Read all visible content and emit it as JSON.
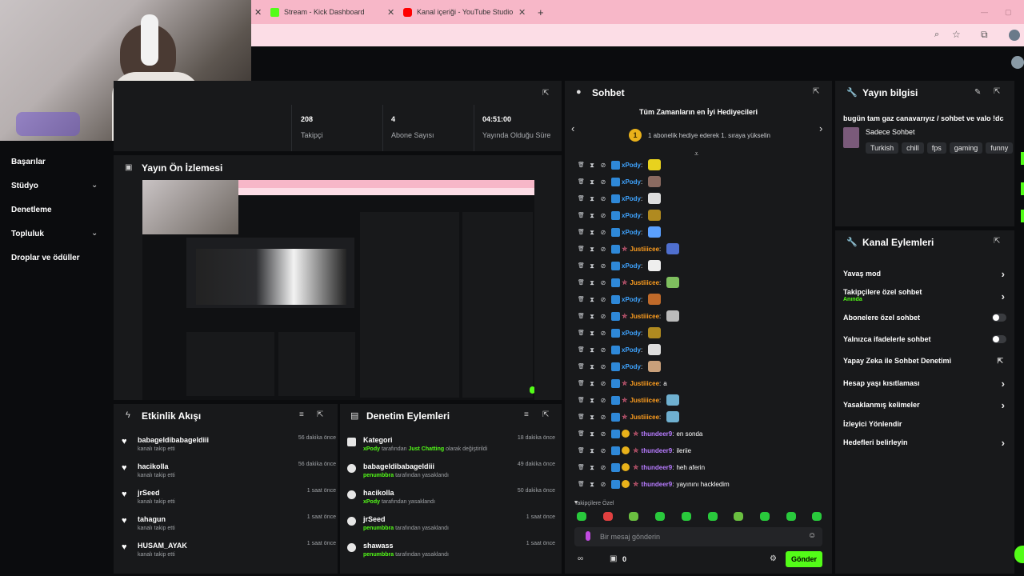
{
  "browser": {
    "tabs": [
      {
        "label": "Stream - Kick Dashboard",
        "icon": "kick-favicon-icon"
      },
      {
        "label": "Kanal içeriği - YouTube Studio",
        "icon": "youtube-favicon-icon"
      }
    ],
    "new_tab": "+"
  },
  "sidebar": {
    "items": [
      {
        "label": "Başarılar"
      },
      {
        "label": "Stüdyo"
      },
      {
        "label": "Denetleme"
      },
      {
        "label": "Topluluk"
      },
      {
        "label": "Droplar ve ödüller"
      }
    ]
  },
  "stats": [
    {
      "value": "208",
      "label": "Takipçi"
    },
    {
      "value": "4",
      "label": "Abone Sayısı"
    },
    {
      "value": "04:51:00",
      "label": "Yayında Olduğu Süre"
    }
  ],
  "preview": {
    "title": "Yayın Ön İzlemesi"
  },
  "activity": {
    "title": "Etkinlik Akışı",
    "rows": [
      {
        "name": "babageldibabageldiii",
        "action": "kanalı takip etti",
        "time": "56 dakika önce"
      },
      {
        "name": "hacikolla",
        "action": "kanalı takip etti",
        "time": "56 dakika önce"
      },
      {
        "name": "jrSeed",
        "action": "kanalı takip etti",
        "time": "1 saat önce"
      },
      {
        "name": "tahagun",
        "action": "kanalı takip etti",
        "time": "1 saat önce"
      },
      {
        "name": "HUSAM_AYAK",
        "action": "kanalı takip etti",
        "time": "1 saat önce"
      }
    ]
  },
  "moderation": {
    "title": "Denetim Eylemleri",
    "rows": [
      {
        "name": "Kategori",
        "actor": "xPody",
        "middle": " tarafından ",
        "highlight": "Just Chatting",
        "rest": " olarak değiştirildi",
        "time": "18 dakika önce",
        "icon": "category-icon"
      },
      {
        "name": "babageldibabageldiii",
        "actor": "penumbbra",
        "middle": " tarafından yasaklandı",
        "highlight": "",
        "rest": "",
        "time": "49 dakika önce",
        "icon": "ban-icon"
      },
      {
        "name": "hacikolla",
        "actor": "xPody",
        "middle": " tarafından yasaklandı",
        "highlight": "",
        "rest": "",
        "time": "50 dakika önce",
        "icon": "ban-icon"
      },
      {
        "name": "jrSeed",
        "actor": "penumbbra",
        "middle": " tarafından yasaklandı",
        "highlight": "",
        "rest": "",
        "time": "1 saat önce",
        "icon": "ban-icon"
      },
      {
        "name": "shawass",
        "actor": "penumbbra",
        "middle": " tarafından yasaklandı",
        "highlight": "",
        "rest": "",
        "time": "1 saat önce",
        "icon": "ban-icon"
      }
    ]
  },
  "chat": {
    "title": "Sohbet",
    "gifters_title": "Tüm Zamanların en İyi Hediyecileri",
    "gifters_sub": "1 abonelik hediye ederek 1. sıraya yükselin",
    "messages": [
      {
        "user": "xPody",
        "color": "#3fa4ff",
        "text": "",
        "star": false,
        "gold": false,
        "emote": "#e8d21e"
      },
      {
        "user": "xPody",
        "color": "#3fa4ff",
        "text": "",
        "star": false,
        "gold": false,
        "emote": "#8a6a60"
      },
      {
        "user": "xPody",
        "color": "#3fa4ff",
        "text": "",
        "star": false,
        "gold": false,
        "emote": "#dddddd"
      },
      {
        "user": "xPody",
        "color": "#3fa4ff",
        "text": "",
        "star": false,
        "gold": false,
        "emote": "#b08a20"
      },
      {
        "user": "xPody",
        "color": "#3fa4ff",
        "text": "",
        "star": false,
        "gold": false,
        "emote": "#5aa0ff"
      },
      {
        "user": "Justiiicee",
        "color": "#ff9e1f",
        "text": "",
        "star": true,
        "gold": false,
        "emote": "#4f6fcf"
      },
      {
        "user": "xPody",
        "color": "#3fa4ff",
        "text": "",
        "star": false,
        "gold": false,
        "emote": "#eeeeee"
      },
      {
        "user": "Justiiicee",
        "color": "#ff9e1f",
        "text": "",
        "star": true,
        "gold": false,
        "emote": "#7fbf5f"
      },
      {
        "user": "xPody",
        "color": "#3fa4ff",
        "text": "",
        "star": false,
        "gold": false,
        "emote": "#c06a2a"
      },
      {
        "user": "Justiiicee",
        "color": "#ff9e1f",
        "text": "",
        "star": true,
        "gold": false,
        "emote": "#bbbbbb"
      },
      {
        "user": "xPody",
        "color": "#3fa4ff",
        "text": "",
        "star": false,
        "gold": false,
        "emote": "#b08a20"
      },
      {
        "user": "xPody",
        "color": "#3fa4ff",
        "text": "",
        "star": false,
        "gold": false,
        "emote": "#dddddd"
      },
      {
        "user": "xPody",
        "color": "#3fa4ff",
        "text": "",
        "star": false,
        "gold": false,
        "emote": "#c9a07a"
      },
      {
        "user": "Justiiicee",
        "color": "#ff9e1f",
        "text": "a",
        "star": true,
        "gold": false,
        "emote": ""
      },
      {
        "user": "Justiiicee",
        "color": "#ff9e1f",
        "text": "",
        "star": true,
        "gold": false,
        "emote": "#6fb0d0"
      },
      {
        "user": "Justiiicee",
        "color": "#ff9e1f",
        "text": "",
        "star": true,
        "gold": false,
        "emote": "#6fb0d0"
      },
      {
        "user": "thundeer9",
        "color": "#b77bff",
        "text": "en sonda",
        "star": true,
        "gold": true,
        "emote": ""
      },
      {
        "user": "thundeer9",
        "color": "#b77bff",
        "text": "ileriie",
        "star": true,
        "gold": true,
        "emote": ""
      },
      {
        "user": "thundeer9",
        "color": "#b77bff",
        "text": "heh aferin",
        "star": true,
        "gold": true,
        "emote": ""
      },
      {
        "user": "thundeer9",
        "color": "#b77bff",
        "text": "yayınını hackledim",
        "star": true,
        "gold": true,
        "emote": ""
      }
    ],
    "followers_only_label": "Takipçilere Özel",
    "input_placeholder": "Bir mesaj gönderin",
    "count": "0",
    "send_label": "Gönder"
  },
  "stream_info": {
    "title": "Yayın bilgisi",
    "stream_title": "bugün tam gaz canavarıyız / sohbet ve valo !dc",
    "category": "Sadece Sohbet",
    "tags": [
      "Turkish",
      "chill",
      "fps",
      "gaming",
      "funny"
    ]
  },
  "channel_actions": {
    "title": "Kanal Eylemleri",
    "items": [
      {
        "label": "Yavaş mod",
        "sub": "",
        "control": "chevron"
      },
      {
        "label": "Takipçilere özel sohbet",
        "sub": "Anında",
        "control": "chevron"
      },
      {
        "label": "Abonelere özel sohbet",
        "sub": "",
        "control": "toggle"
      },
      {
        "label": "Yalnızca ifadelerle sohbet",
        "sub": "",
        "control": "toggle"
      },
      {
        "label": "Yapay Zeka ile Sohbet Denetimi",
        "sub": "",
        "control": "external"
      },
      {
        "label": "Hesap yaşı kısıtlaması",
        "sub": "",
        "control": "chevron"
      },
      {
        "label": "Yasaklanmış kelimeler",
        "sub": "",
        "control": "chevron"
      },
      {
        "label": "İzleyici Yönlendir",
        "sub": "",
        "control": "none"
      },
      {
        "label": "Hedefleri belirleyin",
        "sub": "",
        "control": "chevron"
      }
    ]
  },
  "colors": {
    "accent": "#53fc18",
    "panel": "#18191b",
    "background": "#0b0c0e"
  }
}
